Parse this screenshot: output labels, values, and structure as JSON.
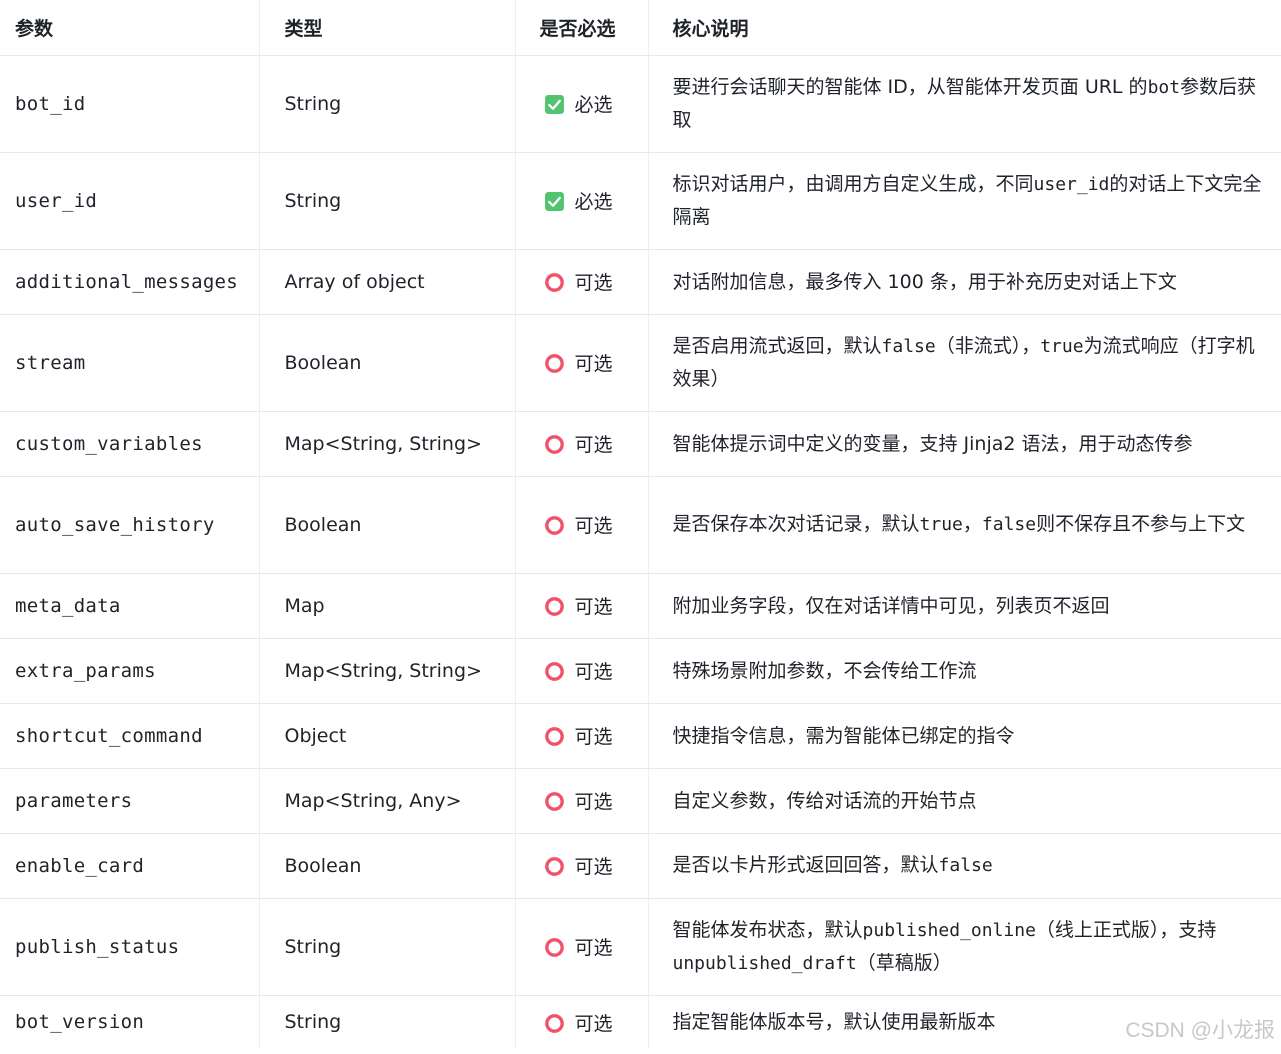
{
  "table": {
    "headers": {
      "param": "参数",
      "type": "类型",
      "required": "是否必选",
      "desc": "核心说明"
    },
    "required_label": "必选",
    "optional_label": "可选",
    "colors": {
      "required_icon": "#52c46f",
      "optional_icon": "#f0526a"
    },
    "rows": [
      {
        "name": "bot_id",
        "type": "String",
        "required": true,
        "desc": [
          {
            "text": "要进行会话聊天的智能体 ID，从智能体开发页面 URL 的",
            "mono": false
          },
          {
            "text": "bot",
            "mono": true
          },
          {
            "text": "参数后获取",
            "mono": false
          }
        ]
      },
      {
        "name": "user_id",
        "type": "String",
        "required": true,
        "desc": [
          {
            "text": "标识对话用户，由调用方自定义生成，不同",
            "mono": false
          },
          {
            "text": "user_id",
            "mono": true
          },
          {
            "text": "的对话上下文完全隔离",
            "mono": false
          }
        ]
      },
      {
        "name": "additional_messages",
        "type": "Array of object",
        "required": false,
        "desc": [
          {
            "text": "对话附加信息，最多传入 100 条，用于补充历史对话上下文",
            "mono": false
          }
        ]
      },
      {
        "name": "stream",
        "type": "Boolean",
        "required": false,
        "desc": [
          {
            "text": "是否启用流式返回，默认",
            "mono": false
          },
          {
            "text": "false",
            "mono": true
          },
          {
            "text": "（非流式），",
            "mono": false
          },
          {
            "text": "true",
            "mono": true
          },
          {
            "text": "为流式响应（打字机效果）",
            "mono": false
          }
        ]
      },
      {
        "name": "custom_variables",
        "type": "Map<String, String>",
        "required": false,
        "desc": [
          {
            "text": "智能体提示词中定义的变量，支持 Jinja2 语法，用于动态传参",
            "mono": false
          }
        ]
      },
      {
        "name": "auto_save_history",
        "type": "Boolean",
        "required": false,
        "desc": [
          {
            "text": "是否保存本次对话记录，默认",
            "mono": false
          },
          {
            "text": "true",
            "mono": true
          },
          {
            "text": "，",
            "mono": false
          },
          {
            "text": "false",
            "mono": true
          },
          {
            "text": "则不保存且不参与上下文",
            "mono": false
          }
        ]
      },
      {
        "name": "meta_data",
        "type": "Map",
        "required": false,
        "desc": [
          {
            "text": "附加业务字段，仅在对话详情中可见，列表页不返回",
            "mono": false
          }
        ]
      },
      {
        "name": "extra_params",
        "type": "Map<String, String>",
        "required": false,
        "desc": [
          {
            "text": "特殊场景附加参数，不会传给工作流",
            "mono": false
          }
        ]
      },
      {
        "name": "shortcut_command",
        "type": "Object",
        "required": false,
        "desc": [
          {
            "text": "快捷指令信息，需为智能体已绑定的指令",
            "mono": false
          }
        ]
      },
      {
        "name": "parameters",
        "type": "Map<String, Any>",
        "required": false,
        "desc": [
          {
            "text": "自定义参数，传给对话流的开始节点",
            "mono": false
          }
        ]
      },
      {
        "name": "enable_card",
        "type": "Boolean",
        "required": false,
        "desc": [
          {
            "text": "是否以卡片形式返回回答，默认",
            "mono": false
          },
          {
            "text": "false",
            "mono": true
          }
        ]
      },
      {
        "name": "publish_status",
        "type": "String",
        "required": false,
        "desc": [
          {
            "text": "智能体发布状态，默认",
            "mono": false
          },
          {
            "text": "published_online",
            "mono": true
          },
          {
            "text": "（线上正式版），支持",
            "mono": false
          },
          {
            "text": "unpublished_draft",
            "mono": true
          },
          {
            "text": "（草稿版）",
            "mono": false
          }
        ]
      },
      {
        "name": "bot_version",
        "type": "String",
        "required": false,
        "desc": [
          {
            "text": "指定智能体版本号，默认使用最新版本",
            "mono": false
          }
        ]
      }
    ]
  },
  "watermark": "CSDN @小龙报"
}
